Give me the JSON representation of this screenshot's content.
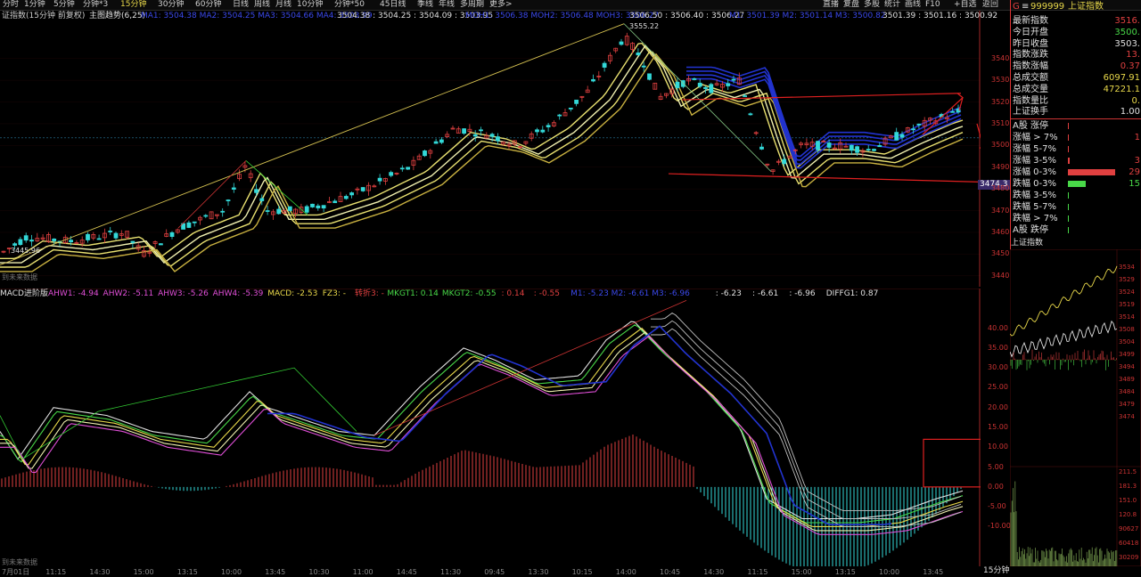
{
  "toolbar": {
    "left_items": [
      "分时",
      "1分钟",
      "5分钟",
      "分钟*3",
      "15分钟",
      "30分钟",
      "60分钟",
      "日线",
      "周线",
      "月线",
      "10分钟",
      "分钟*50",
      "45日线",
      "季线",
      "年线",
      "多周期",
      "更多>"
    ],
    "active_item": "15分钟",
    "right_items": [
      "直播",
      "复盘",
      "多股",
      "统计",
      "画线",
      "F10",
      "+自选",
      "返回"
    ]
  },
  "main": {
    "index_label": "证指数(15分钟 前复权)",
    "indicator_label": "主图趋势(6,25)",
    "ma_readout_1": "MA1: 3504.38  MA2: 3504.25  MA3: 3504.66  MA4: 3503.99",
    "values_1": "3504.38 : 3504.25 : 3504.09 : 3503.95",
    "ma_readout_2": "MOH1: 3506.38  MOH2: 3506.48  MOH3: 3506.27",
    "values_2": "3506.50 : 3506.40 : 3506.27",
    "ma_readout_3": "M1: 3501.39  M2: 3501.14  M3: 3500.82",
    "values_3": "3501.39 : 3501.16 : 3500.92",
    "peak_label": "3555.22",
    "low_label": "3445.96",
    "price_tag": "3474.3",
    "no_future_data": "到未来数据",
    "axis_ticks": [
      "3540",
      "3530",
      "3520",
      "3510",
      "3500",
      "3490",
      "3480",
      "3470",
      "3460",
      "3450",
      "3440"
    ]
  },
  "sub": {
    "name": "MACD进阶版",
    "readout": [
      {
        "text": "AHW1: -4.94",
        "color": "#e04fd8"
      },
      {
        "text": "AHW2: -5.11",
        "color": "#e04fd8"
      },
      {
        "text": "AHW3: -5.26",
        "color": "#e04fd8"
      },
      {
        "text": "AHW4: -5.39",
        "color": "#e04fd8"
      },
      {
        "text": "MACD: -2.53",
        "color": "#e8d84a"
      },
      {
        "text": "FZ3: -",
        "color": "#e8d84a"
      },
      {
        "text": "转折3: -",
        "color": "#e04040"
      },
      {
        "text": "MKGT1: 0.14",
        "color": "#48d848"
      },
      {
        "text": "MKGT2: -0.55",
        "color": "#48d848"
      },
      {
        "text": ": 0.14",
        "color": "#e04040"
      },
      {
        "text": ": -0.55",
        "color": "#e04040"
      },
      {
        "text": "M1: -5.23  M2: -6.61  M3: -6.96",
        "color": "#3a48e8"
      },
      {
        "text": ": -6.23",
        "color": "#e0e0e0"
      },
      {
        "text": ": -6.61",
        "color": "#e0e0e0"
      },
      {
        "text": ": -6.96",
        "color": "#e0e0e0"
      },
      {
        "text": "DIFFG1: 0.87",
        "color": "#e0e0e0"
      }
    ],
    "axis_ticks": [
      "40.00",
      "35.00",
      "30.00",
      "25.00",
      "20.00",
      "15.00",
      "10.00",
      "5.00",
      "0.00",
      "-5.00",
      "-10.00"
    ],
    "no_future_data": "到未来数据"
  },
  "time_axis": [
    "7月01日",
    "11:15",
    "14:30",
    "15:00",
    "13:15",
    "10:00",
    "13:45",
    "10:30",
    "11:00",
    "14:45",
    "11:30",
    "09:45",
    "13:30",
    "10:15",
    "14:00",
    "10:45",
    "14:30",
    "11:15",
    "15:00",
    "13:15",
    "10:00",
    "13:45"
  ],
  "period_label": "15分钟",
  "quote_panel": {
    "header_code": "999999",
    "header_name": "上证指数",
    "header_prefix": "G",
    "rows": [
      {
        "label": "最新指数",
        "value": "3516.",
        "color": "#e04040"
      },
      {
        "label": "今日开盘",
        "value": "3500.",
        "color": "#48d848"
      },
      {
        "label": "昨日收盘",
        "value": "3503.",
        "color": "#e0e0e0"
      },
      {
        "label": "指数涨跌",
        "value": "13.",
        "color": "#e04040"
      },
      {
        "label": "指数涨幅",
        "value": "0.37",
        "color": "#e04040"
      },
      {
        "label": "总成交额",
        "value": "6097.91",
        "color": "#e8d84a"
      },
      {
        "label": "总成交量",
        "value": "47221.1",
        "color": "#e8d84a"
      },
      {
        "label": "指数量比",
        "value": "0.",
        "color": "#e8d84a"
      },
      {
        "label": "上证换手",
        "value": "1.00",
        "color": "#e0e0e0"
      }
    ],
    "breadth": [
      {
        "label": "A股 涨停",
        "value": "",
        "color": "#e04040",
        "bar": 0.0
      },
      {
        "label": "涨幅 > 7%",
        "value": "1",
        "color": "#e04040",
        "bar": 0.02
      },
      {
        "label": "涨幅 5-7%",
        "value": "",
        "color": "#e04040",
        "bar": 0.0
      },
      {
        "label": "涨幅 3-5%",
        "value": "3",
        "color": "#e04040",
        "bar": 0.03
      },
      {
        "label": "涨幅 0-3%",
        "value": "29",
        "color": "#e04040",
        "bar": 0.95
      },
      {
        "label": "跌幅 0-3%",
        "value": "15",
        "color": "#48d848",
        "bar": 0.35
      },
      {
        "label": "跌幅 3-5%",
        "value": "",
        "color": "#48d848",
        "bar": 0.0
      },
      {
        "label": "跌幅 5-7%",
        "value": "",
        "color": "#48d848",
        "bar": 0.0
      },
      {
        "label": "跌幅 > 7%",
        "value": "",
        "color": "#48d848",
        "bar": 0.0
      },
      {
        "label": "A股 跌停",
        "value": "",
        "color": "#48d848",
        "bar": 0.0
      }
    ],
    "mini_title": "上证指数",
    "mini_axis": [
      "3534",
      "3529",
      "3524",
      "3519",
      "3514",
      "3508",
      "3504",
      "3499",
      "3494",
      "3489",
      "3484",
      "3479",
      "3474"
    ],
    "mini_vol_axis": [
      "211.5",
      "181.3",
      "151.0",
      "120.8",
      "90627",
      "60418",
      "30209"
    ]
  },
  "colors": {
    "up": "#e04040",
    "down": "#33d8d8",
    "grid": "#3a0a0a",
    "axis_red": "#c33",
    "ma_yellow": "#e8e070",
    "ma_blue": "#2233d0",
    "annot_red": "#e02020",
    "trend_yellow": "#d4c050"
  }
}
